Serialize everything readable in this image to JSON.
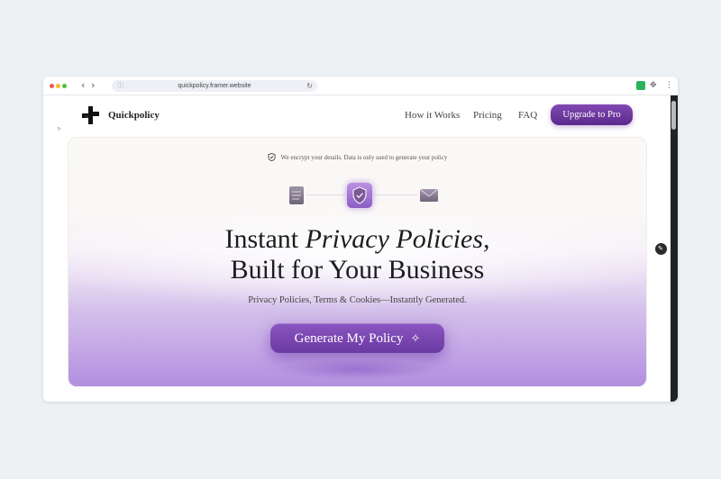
{
  "browser": {
    "url": "quickpolicy.framer.website",
    "back_glyph": "‹",
    "forward_glyph": "›",
    "reload_glyph": "↻",
    "lock_glyph": "ⓘ",
    "menu_glyph": "⋮",
    "puzzle_glyph": "✥"
  },
  "nav": {
    "brand": "Quickpolicy",
    "links": [
      "How it Works",
      "Pricing",
      "FAQ"
    ],
    "cta": "Upgrade to Pro"
  },
  "hero": {
    "secure_note": "We encrypt your details. Data is only used to generate your policy",
    "headline_line1_plain": "Instant ",
    "headline_line1_italic": "Privacy Policies,",
    "headline_line2": "Built for Your Business",
    "subheadline": "Privacy Policies, Terms & Cookies—Instantly Generated.",
    "cta_label": "Generate My Policy",
    "cta_icon": "✧"
  },
  "colors": {
    "brand_purple": "#6b3aa3",
    "hero_gradient_bottom": "#b38fdf",
    "page_background": "#eef1f4"
  },
  "icons": [
    "document-icon",
    "shield-check-icon",
    "mail-icon",
    "sparkle-icon",
    "pen-icon"
  ]
}
